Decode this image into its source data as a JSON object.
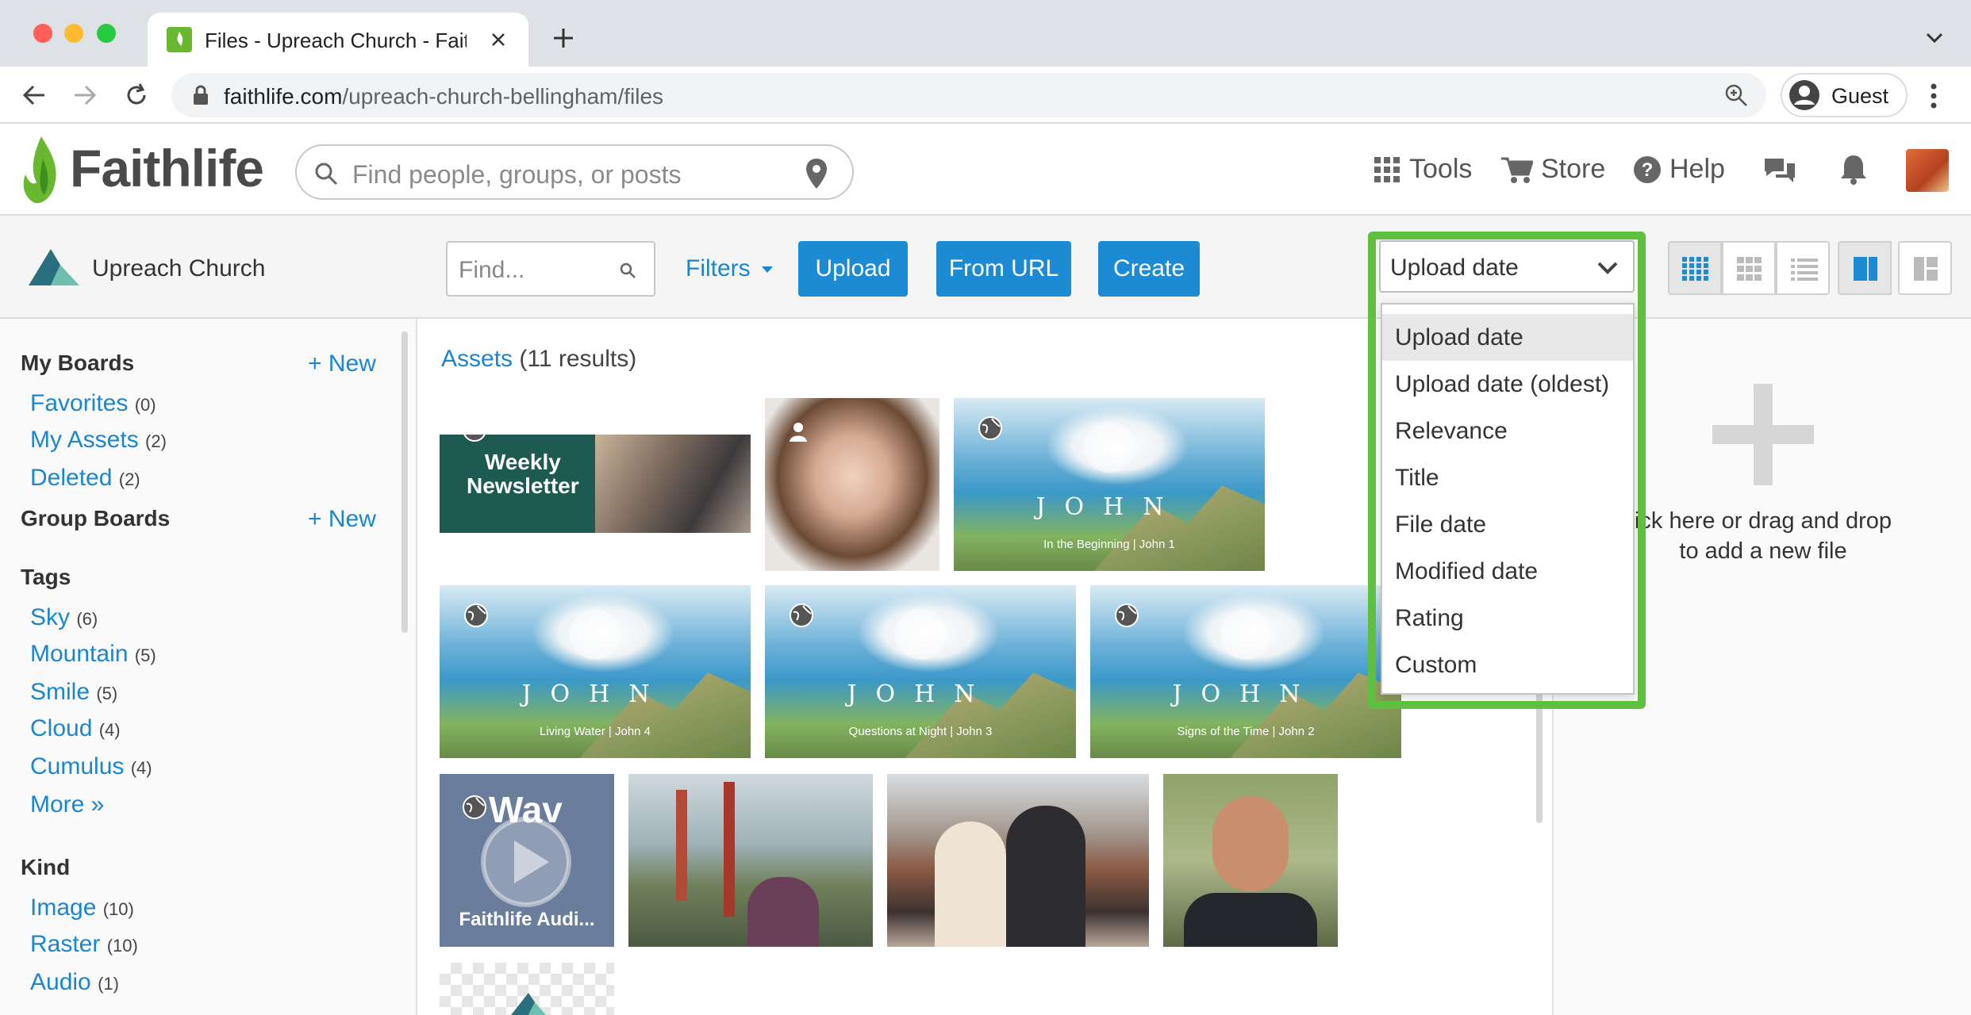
{
  "browser": {
    "tab_title": "Files - Upreach Church - Faithlife",
    "url_host": "faithlife.com",
    "url_path": "/upreach-church-bellingham/files",
    "guest_label": "Guest"
  },
  "header": {
    "logo_text": "Faithlife",
    "search_placeholder": "Find people, groups, or posts",
    "nav": {
      "tools": "Tools",
      "store": "Store",
      "help": "Help"
    }
  },
  "toolbar": {
    "group_name": "Upreach Church",
    "find_placeholder": "Find...",
    "filters_label": "Filters",
    "upload_label": "Upload",
    "from_url_label": "From URL",
    "create_label": "Create",
    "sort_selected": "Upload date"
  },
  "sort_options": [
    "Upload date",
    "Upload date (oldest)",
    "Relevance",
    "Title",
    "File date",
    "Modified date",
    "Rating",
    "Custom"
  ],
  "sidebar": {
    "my_boards": {
      "title": "My Boards",
      "new_label": "+ New",
      "items": [
        {
          "label": "Favorites",
          "count": "(0)"
        },
        {
          "label": "My Assets",
          "count": "(2)"
        },
        {
          "label": "Deleted",
          "count": "(2)"
        }
      ]
    },
    "group_boards": {
      "title": "Group Boards",
      "new_label": "+ New"
    },
    "tags": {
      "title": "Tags",
      "items": [
        {
          "label": "Sky",
          "count": "(6)"
        },
        {
          "label": "Mountain",
          "count": "(5)"
        },
        {
          "label": "Smile",
          "count": "(5)"
        },
        {
          "label": "Cloud",
          "count": "(4)"
        },
        {
          "label": "Cumulus",
          "count": "(4)"
        }
      ],
      "more_label": "More »"
    },
    "kind": {
      "title": "Kind",
      "items": [
        {
          "label": "Image",
          "count": "(10)"
        },
        {
          "label": "Raster",
          "count": "(10)"
        },
        {
          "label": "Audio",
          "count": "(1)"
        }
      ]
    }
  },
  "main": {
    "assets_link": "Assets",
    "results_text": "(11 results)",
    "thumbs": {
      "newsletter_line1": "Weekly",
      "newsletter_line2": "Newsletter",
      "john_word": "JOHN",
      "john1_sub": "In the Beginning | John 1",
      "john4_sub": "Living Water | John 4",
      "john3_sub": "Questions at Night | John 3",
      "john2_sub": "Signs of the Time | John 2",
      "audio_badge": "Wav",
      "audio_title": "Faithlife Audi..."
    }
  },
  "right_panel": {
    "drop_line1": "ick here or drag and drop",
    "drop_line2": "to add a new file"
  },
  "colors": {
    "accent": "#1d8bd4",
    "highlight": "#5fbf3f",
    "logo_green": "#6ab82f"
  }
}
